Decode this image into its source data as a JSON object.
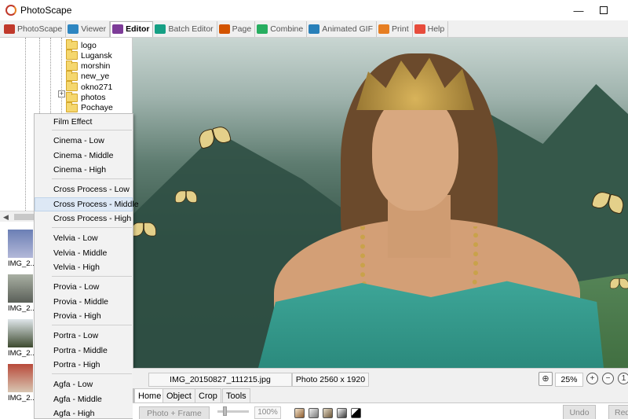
{
  "window": {
    "title": "PhotoScape",
    "minimize": "—",
    "close": "✕"
  },
  "tabs": [
    {
      "label": "PhotoScape",
      "icon": "photoscape-icon",
      "color": "#c0392b"
    },
    {
      "label": "Viewer",
      "icon": "viewer-icon",
      "color": "#2e86c1"
    },
    {
      "label": "Editor",
      "icon": "editor-icon",
      "color": "#7d3c98"
    },
    {
      "label": "Batch Editor",
      "icon": "batch-editor-icon",
      "color": "#16a085"
    },
    {
      "label": "Page",
      "icon": "page-icon",
      "color": "#d35400"
    },
    {
      "label": "Combine",
      "icon": "combine-icon",
      "color": "#27ae60"
    },
    {
      "label": "Animated GIF",
      "icon": "animated-gif-icon",
      "color": "#2980b9"
    },
    {
      "label": "Print",
      "icon": "print-icon",
      "color": "#e67e22"
    },
    {
      "label": "Help",
      "icon": "help-icon",
      "color": "#e74c3c"
    }
  ],
  "active_tab": "Editor",
  "tree": {
    "items": [
      "logo",
      "Lugansk",
      "morshin",
      "new_ye",
      "okno271",
      "photos",
      "Pochaye"
    ]
  },
  "thumbnails": [
    {
      "label": "IMG_2..."
    },
    {
      "label": "IMG_2..."
    },
    {
      "label": "IMG_2..."
    },
    {
      "label": "IMG_2..."
    }
  ],
  "film_menu": {
    "header": "Film Effect",
    "groups": [
      [
        "Cinema - Low",
        "Cinema - Middle",
        "Cinema - High"
      ],
      [
        "Cross Process - Low",
        "Cross Process - Middle",
        "Cross Process - High"
      ],
      [
        "Velvia - Low",
        "Velvia - Middle",
        "Velvia - High"
      ],
      [
        "Provia - Low",
        "Provia - Middle",
        "Provia - High"
      ],
      [
        "Portra - Low",
        "Portra - Middle",
        "Portra - High"
      ],
      [
        "Agfa - Low",
        "Agfa - Middle",
        "Agfa - High"
      ]
    ],
    "highlighted": "Cross Process - Middle"
  },
  "info": {
    "filename": "IMG_20150827_111215.jpg",
    "size": "Photo 2560 x 1920",
    "zoom": "25%"
  },
  "editor_tabs": [
    "Home",
    "Object",
    "Crop",
    "Tools"
  ],
  "editor": {
    "photo_frame": "Photo + Frame",
    "percent": "100%",
    "undo": "Undo",
    "redo": "Redo"
  }
}
